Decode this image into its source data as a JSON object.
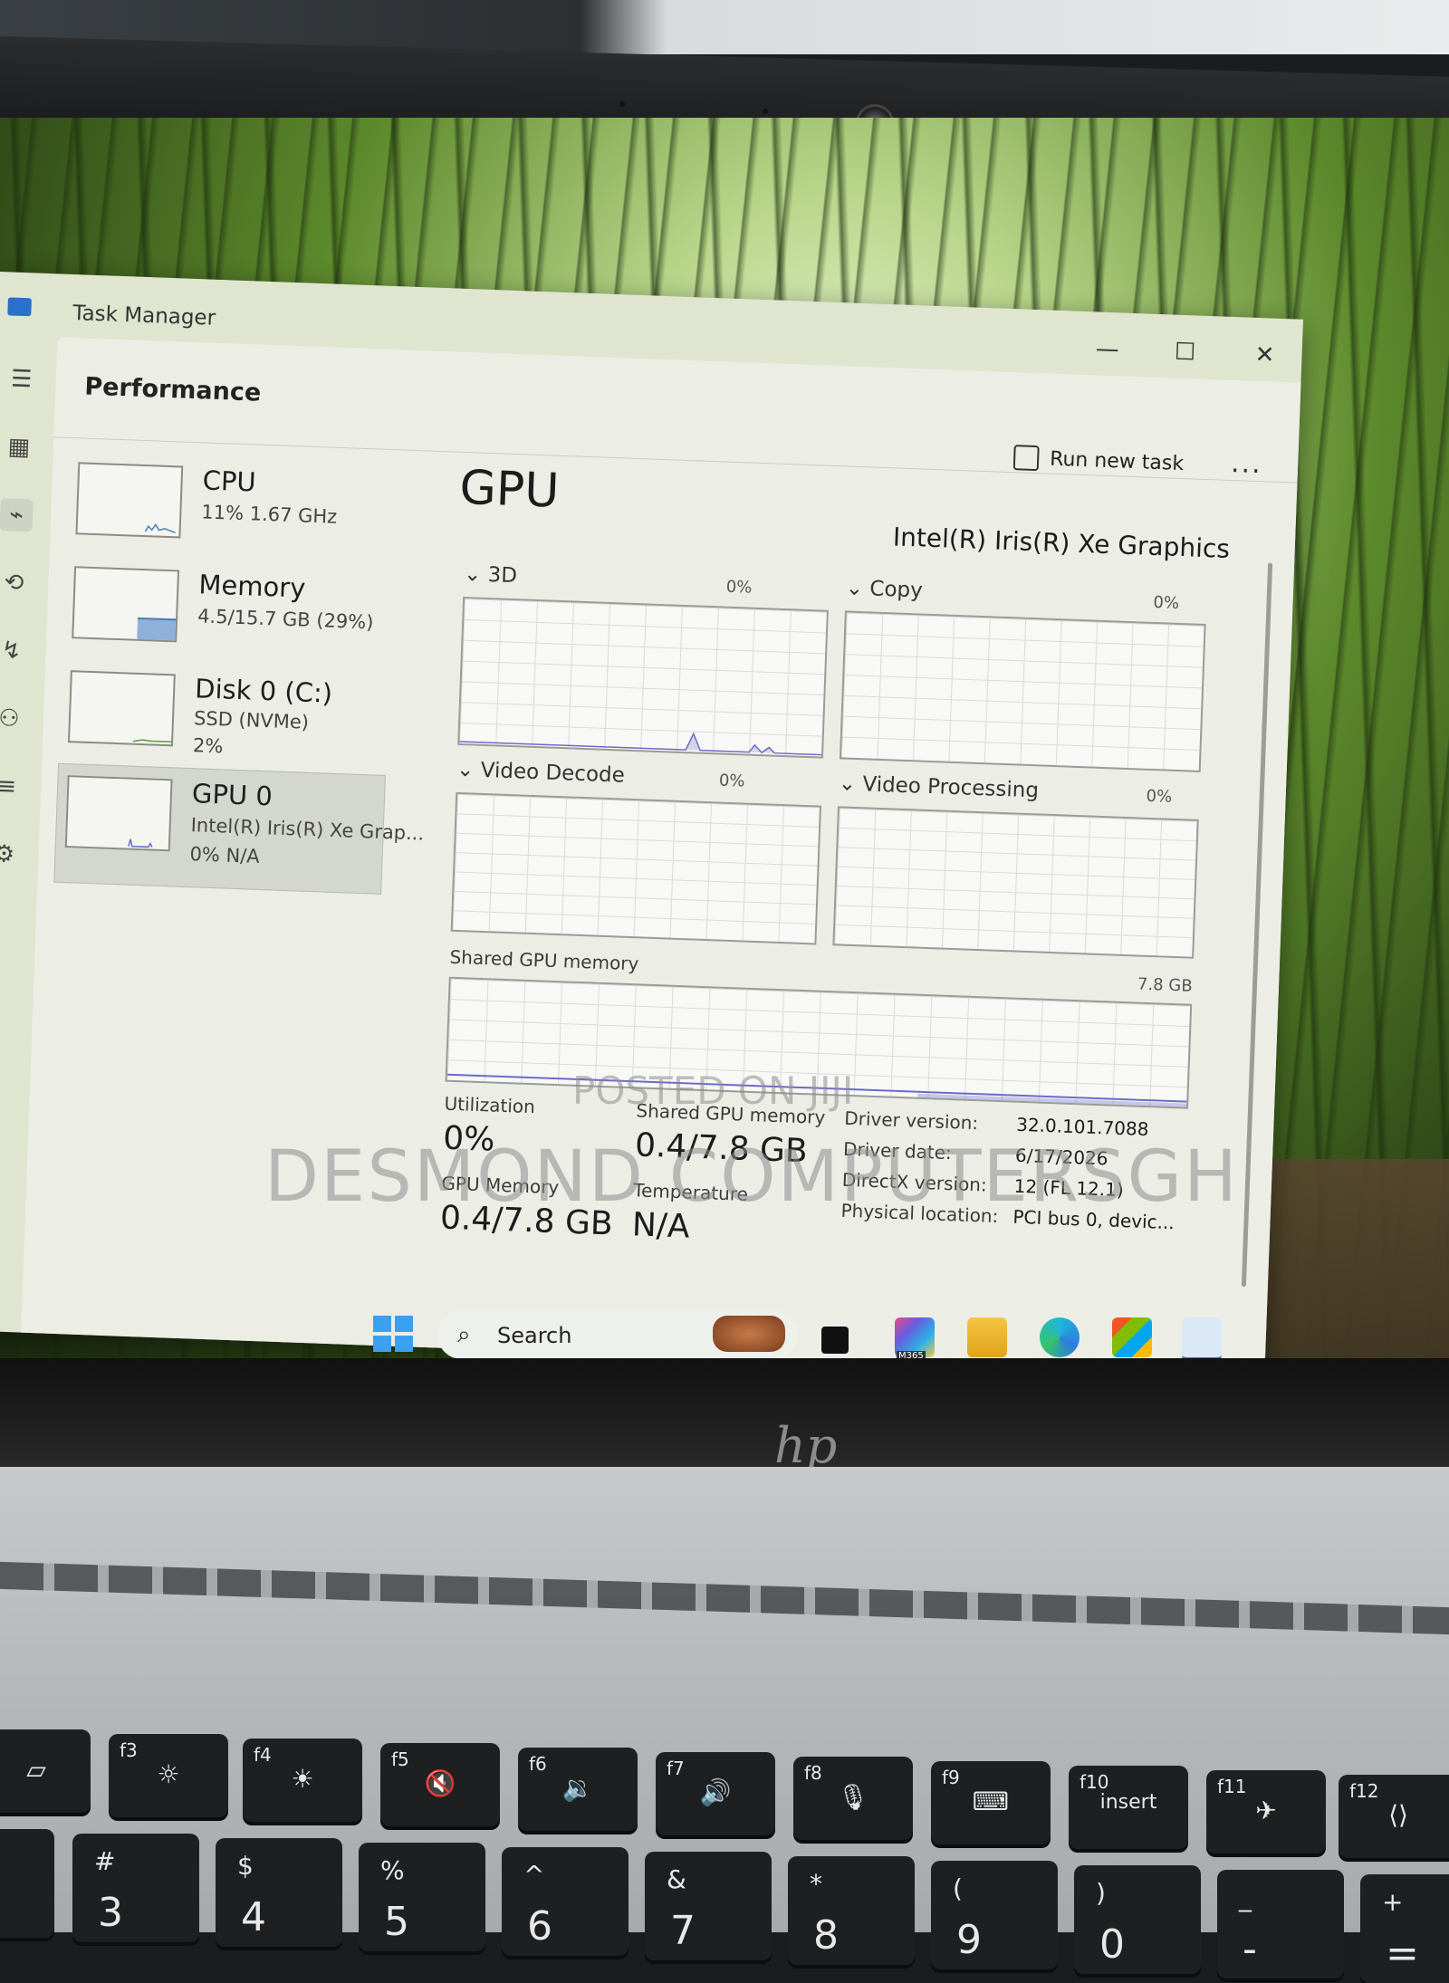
{
  "window": {
    "title": "Task Manager",
    "controls": {
      "minimize": "—",
      "maximize": "☐",
      "close": "✕"
    }
  },
  "page": {
    "title": "Performance",
    "run_new_task": "Run new task",
    "more": "..."
  },
  "resources": [
    {
      "name": "CPU",
      "sub1": "11%  1.67 GHz",
      "sub2": "",
      "selected": false
    },
    {
      "name": "Memory",
      "sub1": "4.5/15.7 GB (29%)",
      "sub2": "",
      "selected": false
    },
    {
      "name": "Disk 0 (C:)",
      "sub1": "SSD (NVMe)",
      "sub2": "2%",
      "selected": false
    },
    {
      "name": "GPU 0",
      "sub1": "Intel(R) Iris(R) Xe Grap...",
      "sub2": "0%  N/A",
      "selected": true
    }
  ],
  "gpu": {
    "title": "GPU",
    "model": "Intel(R) Iris(R) Xe Graphics",
    "engines": [
      {
        "label": "3D",
        "percent": "0%"
      },
      {
        "label": "Copy",
        "percent": "0%"
      },
      {
        "label": "Video Decode",
        "percent": "0%"
      },
      {
        "label": "Video Processing",
        "percent": "0%"
      }
    ],
    "shared_memory_graph": {
      "label": "Shared GPU memory",
      "max": "7.8 GB"
    },
    "stats": {
      "utilization_label": "Utilization",
      "utilization_value": "0%",
      "shared_label": "Shared GPU memory",
      "shared_value": "0.4/7.8 GB",
      "gpu_memory_label": "GPU Memory",
      "gpu_memory_value": "0.4/7.8 GB",
      "temperature_label": "Temperature",
      "temperature_value": "N/A"
    },
    "details": [
      {
        "key": "Driver version:",
        "value": "32.0.101.7088"
      },
      {
        "key": "Driver date:",
        "value": "6/17/2026"
      },
      {
        "key": "DirectX version:",
        "value": "12 (FL 12.1)"
      },
      {
        "key": "Physical location:",
        "value": "PCI bus 0, devic..."
      }
    ]
  },
  "taskbar": {
    "search_label": "Search",
    "icons": [
      "windows-start-icon",
      "task-view-icon",
      "m365-icon",
      "file-explorer-icon",
      "edge-icon",
      "store-icon",
      "task-manager-icon"
    ],
    "m365_text": "M365"
  },
  "keyboard": {
    "function_keys": [
      {
        "fn": "f3",
        "sym": "☼"
      },
      {
        "fn": "f4",
        "sym": "☀"
      },
      {
        "fn": "f5",
        "sym": "🔇"
      },
      {
        "fn": "f6",
        "sym": "🔉"
      },
      {
        "fn": "f7",
        "sym": "🔊"
      },
      {
        "fn": "f8",
        "sym": "🎙"
      },
      {
        "fn": "f9",
        "sym": "⌨"
      },
      {
        "fn": "f10",
        "sym": "insert"
      },
      {
        "fn": "f11",
        "sym": "✈"
      },
      {
        "fn": "f12",
        "sym": "⟨⟩"
      }
    ],
    "number_keys": [
      {
        "top": "#",
        "bot": "3"
      },
      {
        "top": "$",
        "bot": "4"
      },
      {
        "top": "%",
        "bot": "5"
      },
      {
        "top": "^",
        "bot": "6"
      },
      {
        "top": "&",
        "bot": "7"
      },
      {
        "top": "*",
        "bot": "8"
      },
      {
        "top": "(",
        "bot": "9"
      },
      {
        "top": ")",
        "bot": "0"
      },
      {
        "top": "_",
        "bot": "-"
      },
      {
        "top": "+",
        "bot": "="
      }
    ],
    "brand": "hp"
  },
  "watermarks": {
    "posted": "POSTED ON JIJI",
    "seller": "DESMOND COMPUTERSGH"
  },
  "colors": {
    "accent": "#2a6fc9",
    "gpu_graph_line": "#6b6bc9",
    "memory_fill": "#8fb1d9"
  }
}
